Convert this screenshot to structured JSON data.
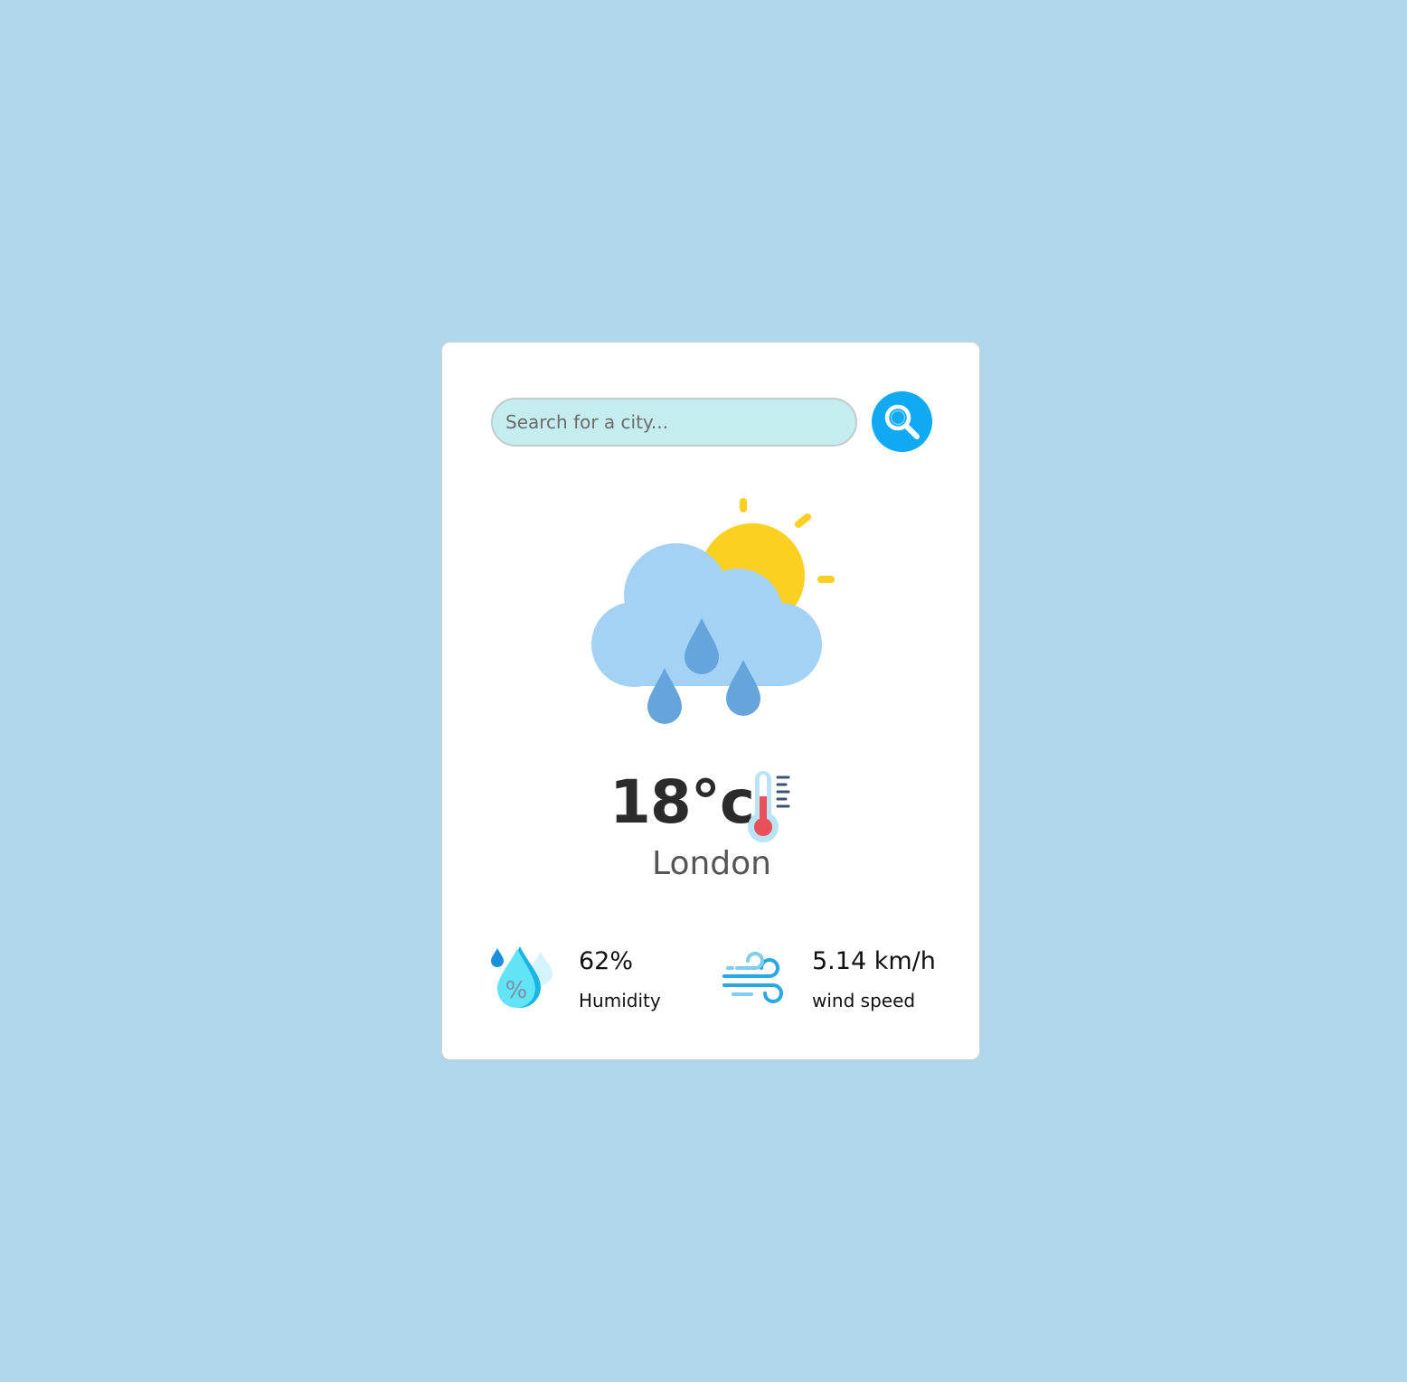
{
  "search": {
    "placeholder": "Search for a city...",
    "button_icon": "search-icon"
  },
  "weather": {
    "condition_icon": "sun-cloud-rain-icon",
    "temperature": "18°c",
    "temperature_icon": "thermometer-icon",
    "city": "London"
  },
  "details": {
    "humidity": {
      "icon": "humidity-icon",
      "value": "62%",
      "label": "Humidity"
    },
    "wind": {
      "icon": "wind-icon",
      "value": "5.14 km/h",
      "label": "wind speed"
    }
  },
  "colors": {
    "background": "#b1d5ea",
    "card": "#ffffff",
    "search_field": "#c5ecef",
    "search_button": "#10aaf4"
  }
}
